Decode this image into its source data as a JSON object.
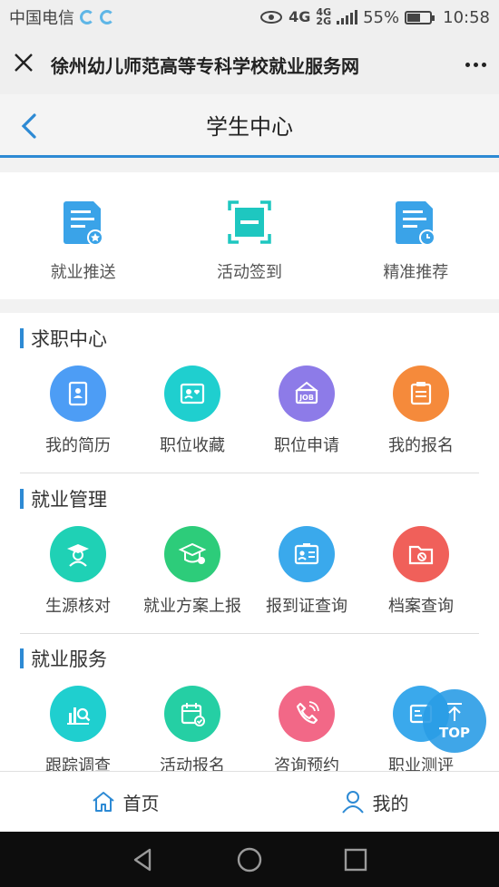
{
  "status_bar": {
    "carrier": "中国电信",
    "network_tag_top": "4G",
    "network_tag_sub": "4G",
    "network_tag_sub2": "2G",
    "battery": "55%",
    "time": "10:58"
  },
  "title_bar": {
    "title": "徐州幼儿师范高等专科学校就业服务网"
  },
  "nav": {
    "title": "学生中心"
  },
  "quick_actions": [
    {
      "label": "就业推送",
      "icon": "document-star-icon"
    },
    {
      "label": "活动签到",
      "icon": "scan-icon"
    },
    {
      "label": "精准推荐",
      "icon": "document-clock-icon"
    }
  ],
  "sections": [
    {
      "title": "求职中心",
      "items": [
        {
          "label": "我的简历",
          "icon": "resume-icon",
          "color": "#4d9df5"
        },
        {
          "label": "职位收藏",
          "icon": "id-card-heart-icon",
          "color": "#1fcfcf"
        },
        {
          "label": "职位申请",
          "icon": "job-sign-icon",
          "color": "#8d7be8"
        },
        {
          "label": "我的报名",
          "icon": "clipboard-icon",
          "color": "#f58a3b"
        }
      ]
    },
    {
      "title": "就业管理",
      "items": [
        {
          "label": "生源核对",
          "icon": "graduate-icon",
          "color": "#1fd1b5"
        },
        {
          "label": "就业方案上报",
          "icon": "mortarboard-icon",
          "color": "#2dcc7a"
        },
        {
          "label": "报到证查询",
          "icon": "certificate-icon",
          "color": "#3aa9ec"
        },
        {
          "label": "档案查询",
          "icon": "folder-icon",
          "color": "#f0605a"
        }
      ]
    },
    {
      "title": "就业服务",
      "items": [
        {
          "label": "跟踪调查",
          "icon": "chart-search-icon",
          "color": "#1fcfcf"
        },
        {
          "label": "活动报名",
          "icon": "calendar-check-icon",
          "color": "#25cfa4"
        },
        {
          "label": "咨询预约",
          "icon": "phone-icon",
          "color": "#f26887"
        },
        {
          "label": "职业测评",
          "icon": "assessment-icon",
          "color": "#3aa9ec"
        }
      ]
    }
  ],
  "top_button": {
    "label": "TOP"
  },
  "tab_bar": [
    {
      "label": "首页",
      "icon": "home-icon"
    },
    {
      "label": "我的",
      "icon": "user-icon"
    }
  ],
  "colors": {
    "accent": "#2d8ad4",
    "quick_icon": "#3aa3e8",
    "quick_icon_teal": "#1ec7c0"
  }
}
